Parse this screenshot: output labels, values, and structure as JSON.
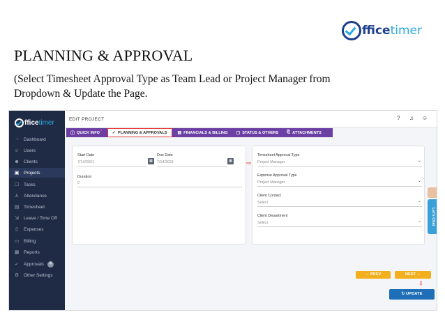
{
  "brand": {
    "part1": "ffice",
    "part2": "timer"
  },
  "slide": {
    "title": "PLANNING & APPROVAL",
    "subtitle": "(Select Timesheet Approval Type as Team Lead  or Project Manager from Dropdown & Update the Page."
  },
  "app": {
    "logo": {
      "part1": "ffice",
      "part2": "timer"
    },
    "sidebar": [
      {
        "label": "Dashboard",
        "icon": "dashboard-icon"
      },
      {
        "label": "Users",
        "icon": "users-icon"
      },
      {
        "label": "Clients",
        "icon": "clients-icon"
      },
      {
        "label": "Projects",
        "icon": "projects-icon"
      },
      {
        "label": "Tasks",
        "icon": "tasks-icon"
      },
      {
        "label": "Attendance",
        "icon": "attendance-icon"
      },
      {
        "label": "Timesheet",
        "icon": "timesheet-icon"
      },
      {
        "label": "Leave / Time Off",
        "icon": "leave-icon"
      },
      {
        "label": "Expenses",
        "icon": "expenses-icon"
      },
      {
        "label": "Billing",
        "icon": "billing-icon"
      },
      {
        "label": "Reports",
        "icon": "reports-icon"
      },
      {
        "label": "Approvals",
        "icon": "approvals-icon",
        "badge": "4"
      },
      {
        "label": "Other Settings",
        "icon": "settings-icon"
      }
    ],
    "page_title": "EDIT PROJECT",
    "tabs": [
      {
        "label": "QUICK INFO",
        "marker": "*"
      },
      {
        "label": "PLANNING & APPROVALS"
      },
      {
        "label": "FINANCIALS & BILLING"
      },
      {
        "label": "STATUS & OTHERS"
      },
      {
        "label": "ATTACHMENTS"
      }
    ],
    "left_card": {
      "start_date_label": "Start Date",
      "start_date_value": "7/14/2021",
      "due_date_label": "Due Date",
      "due_date_value": "7/14/2021",
      "duration_label": "Duration",
      "duration_value": "0"
    },
    "right_card": {
      "timesheet_approval_label": "Timesheet Approval Type",
      "timesheet_approval_value": "Project Manager",
      "expense_approval_label": "Expense Approval Type",
      "expense_approval_value": "Project Manager",
      "client_contact_label": "Client Contact",
      "client_contact_value": "Select",
      "client_department_label": "Client Department",
      "client_department_value": "Select"
    },
    "chat_label": "Let's Chat",
    "prev_label": "← PREV",
    "next_label": "NEXT →",
    "update_label": "UPDATE"
  },
  "colors": {
    "sidebar": "#1f2a44",
    "tabs": "#6b3fa3",
    "accent_yellow": "#f2b01e",
    "update_blue": "#1e6fb8"
  }
}
